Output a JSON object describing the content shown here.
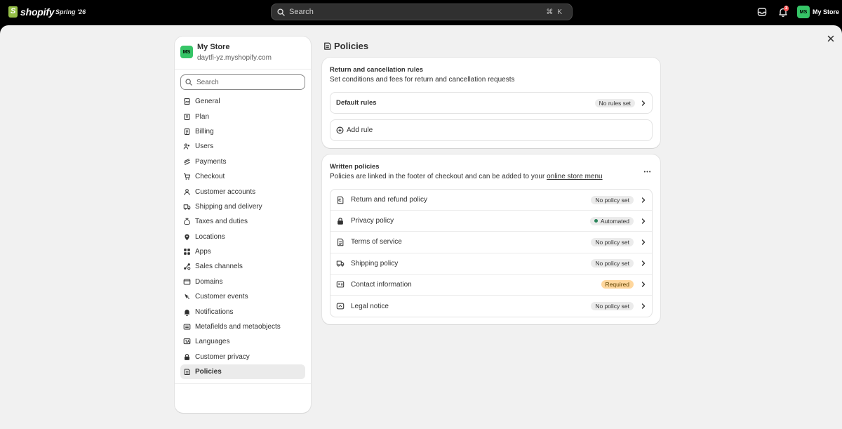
{
  "topbar": {
    "logo_text": "shopify",
    "version": "Spring '26",
    "search_placeholder": "Search",
    "shortcut": "⌘K",
    "notification_count": "3",
    "avatar_initials": "MS",
    "store_name": "My Store"
  },
  "sidebar": {
    "store_initials": "MS",
    "store_name": "My Store",
    "store_domain": "daytfi-yz.myshopify.com",
    "search_placeholder": "Search",
    "items": [
      {
        "label": "General",
        "icon": "store-icon"
      },
      {
        "label": "Plan",
        "icon": "plan-icon"
      },
      {
        "label": "Billing",
        "icon": "billing-icon"
      },
      {
        "label": "Users",
        "icon": "users-icon"
      },
      {
        "label": "Payments",
        "icon": "payments-icon"
      },
      {
        "label": "Checkout",
        "icon": "cart-icon"
      },
      {
        "label": "Customer accounts",
        "icon": "person-icon"
      },
      {
        "label": "Shipping and delivery",
        "icon": "truck-icon"
      },
      {
        "label": "Taxes and duties",
        "icon": "tax-icon"
      },
      {
        "label": "Locations",
        "icon": "location-icon"
      },
      {
        "label": "Apps",
        "icon": "apps-icon"
      },
      {
        "label": "Sales channels",
        "icon": "channels-icon"
      },
      {
        "label": "Domains",
        "icon": "globe-icon"
      },
      {
        "label": "Customer events",
        "icon": "cursor-icon"
      },
      {
        "label": "Notifications",
        "icon": "bell-icon"
      },
      {
        "label": "Metafields and metaobjects",
        "icon": "metafields-icon"
      },
      {
        "label": "Languages",
        "icon": "language-icon"
      },
      {
        "label": "Customer privacy",
        "icon": "lock-icon"
      },
      {
        "label": "Policies",
        "icon": "policies-icon",
        "active": true
      }
    ]
  },
  "page": {
    "title": "Policies"
  },
  "return_card": {
    "title": "Return and cancellation rules",
    "subtitle": "Set conditions and fees for return and cancellation requests",
    "default_rules_label": "Default rules",
    "default_rules_badge": "No rules set",
    "add_rule_label": "Add rule"
  },
  "written_card": {
    "title": "Written policies",
    "subtitle_prefix": "Policies are linked in the footer of checkout and can be added to your ",
    "subtitle_link": "online store menu",
    "policies": [
      {
        "label": "Return and refund policy",
        "badge": "No policy set",
        "icon": "return-icon"
      },
      {
        "label": "Privacy policy",
        "badge": "Automated",
        "icon": "lock-icon",
        "status": "automated",
        "status_color": "#29845a"
      },
      {
        "label": "Terms of service",
        "badge": "No policy set",
        "icon": "document-icon"
      },
      {
        "label": "Shipping policy",
        "badge": "No policy set",
        "icon": "truck-icon"
      },
      {
        "label": "Contact information",
        "badge": "Required",
        "icon": "contact-icon",
        "status": "required",
        "status_color": "#ffd79d"
      },
      {
        "label": "Legal notice",
        "badge": "No policy set",
        "icon": "legal-icon"
      }
    ]
  }
}
